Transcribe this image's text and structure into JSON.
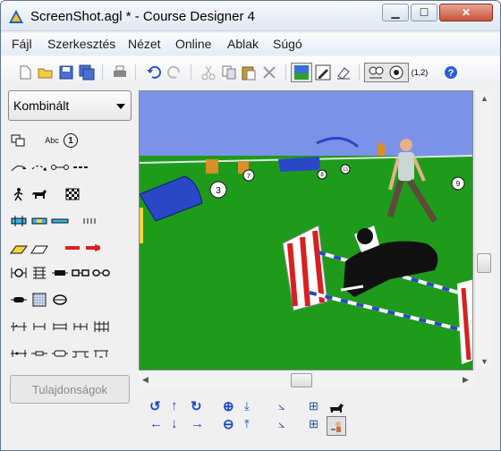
{
  "window": {
    "title": "ScreenShot.agl * - Course Designer 4",
    "controls": {
      "minimize": "▁",
      "maximize": "☐",
      "close": "✕"
    }
  },
  "menu": [
    "Fájl",
    "Szerkesztés",
    "Nézet",
    "Online",
    "Ablak",
    "Súgó"
  ],
  "toolbar": {
    "icons": [
      "new-file-icon",
      "open-folder-icon",
      "save-icon",
      "save-all-icon",
      "print-icon",
      "undo-icon",
      "redo-icon",
      "cut-icon",
      "copy-icon",
      "paste-icon",
      "delete-icon",
      "3d-view-icon",
      "pencil-icon",
      "eraser-icon",
      "course-view-icon",
      "dog-path-icon",
      "help-icon"
    ],
    "numbering_label": "(1,2)"
  },
  "sidebar": {
    "category_select": "Kombinált",
    "tools_text": {
      "abc": "Abc",
      "one": "1"
    },
    "properties_button": "Tulajdonságok"
  },
  "viewport": {
    "number_labels": [
      "3",
      "7",
      "8",
      "13",
      "9"
    ]
  },
  "colors": {
    "sky": "#7a93e8",
    "grass": "#1f9b1b",
    "tunnel": "#2a47c8",
    "jump_red": "#d82020",
    "nav_blue": "#1a49c7"
  }
}
